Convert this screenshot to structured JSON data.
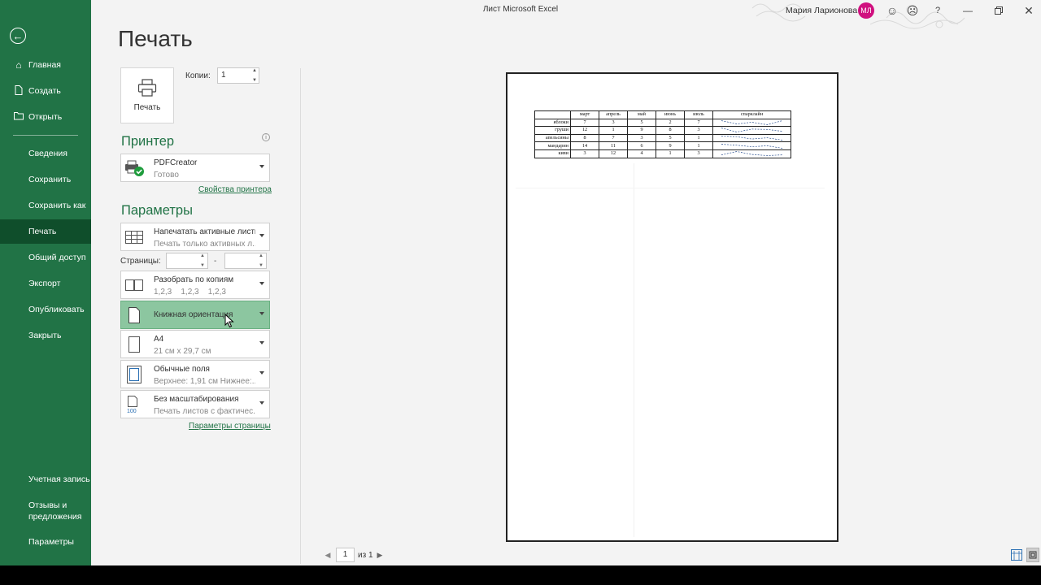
{
  "window": {
    "title": "Лист Microsoft Excel",
    "user_name": "Мария Ларионова",
    "user_initials": "МЛ",
    "help_label": "?"
  },
  "sidebar": {
    "back_icon": "back-arrow-icon",
    "items": [
      {
        "label": "Главная",
        "icon": "home-icon"
      },
      {
        "label": "Создать",
        "icon": "new-document-icon"
      },
      {
        "label": "Открыть",
        "icon": "open-folder-icon"
      },
      {
        "label": "Сведения"
      },
      {
        "label": "Сохранить"
      },
      {
        "label": "Сохранить как"
      },
      {
        "label": "Печать",
        "active": true
      },
      {
        "label": "Общий доступ"
      },
      {
        "label": "Экспорт"
      },
      {
        "label": "Опубликовать"
      },
      {
        "label": "Закрыть"
      }
    ],
    "bottom_items": [
      {
        "label": "Учетная запись"
      },
      {
        "label": "Отзывы и предложения",
        "line1": "Отзывы и",
        "line2": "предложения"
      },
      {
        "label": "Параметры"
      }
    ],
    "accent_color": "#217346"
  },
  "print": {
    "heading": "Печать",
    "print_button_label": "Печать",
    "copies_label": "Копии:",
    "copies_value": "1",
    "printer_section": "Принтер",
    "printer": {
      "name": "PDFCreator",
      "status": "Готово"
    },
    "printer_properties_link": "Свойства принтера",
    "settings_section": "Параметры",
    "settings": {
      "what": {
        "title": "Напечатать активные листы",
        "subtitle": "Печать только активных л..."
      },
      "pages_label": "Страницы:",
      "pages_from": "",
      "pages_to": "",
      "pages_dash": "-",
      "collate": {
        "title": "Разобрать по копиям",
        "subtitle": "1,2,3    1,2,3    1,2,3"
      },
      "orientation": {
        "title": "Книжная ориентация"
      },
      "paper": {
        "title": "A4",
        "subtitle": "21 см x 29,7 см"
      },
      "margins": {
        "title": "Обычные поля",
        "subtitle": "Верхнее: 1,91 см Нижнее:..."
      },
      "scaling": {
        "title": "Без масштабирования",
        "subtitle": "Печать листов с фактичес..."
      }
    },
    "page_setup_link": "Параметры страницы"
  },
  "preview": {
    "current_page": "1",
    "of_label": "из 1",
    "table": {
      "headers": [
        "",
        "март",
        "апрель",
        "май",
        "июнь",
        "июль",
        "спарклайн"
      ],
      "rows": [
        {
          "name": "яблоки",
          "values": [
            "7",
            "3",
            "5",
            "2",
            "7"
          ]
        },
        {
          "name": "груши",
          "values": [
            "12",
            "1",
            "9",
            "8",
            "3"
          ]
        },
        {
          "name": "апельсины",
          "values": [
            "8",
            "7",
            "3",
            "5",
            "1"
          ]
        },
        {
          "name": "мандарин",
          "values": [
            "14",
            "11",
            "6",
            "9",
            "1"
          ]
        },
        {
          "name": "киви",
          "values": [
            "3",
            "12",
            "4",
            "1",
            "3"
          ]
        }
      ]
    }
  }
}
